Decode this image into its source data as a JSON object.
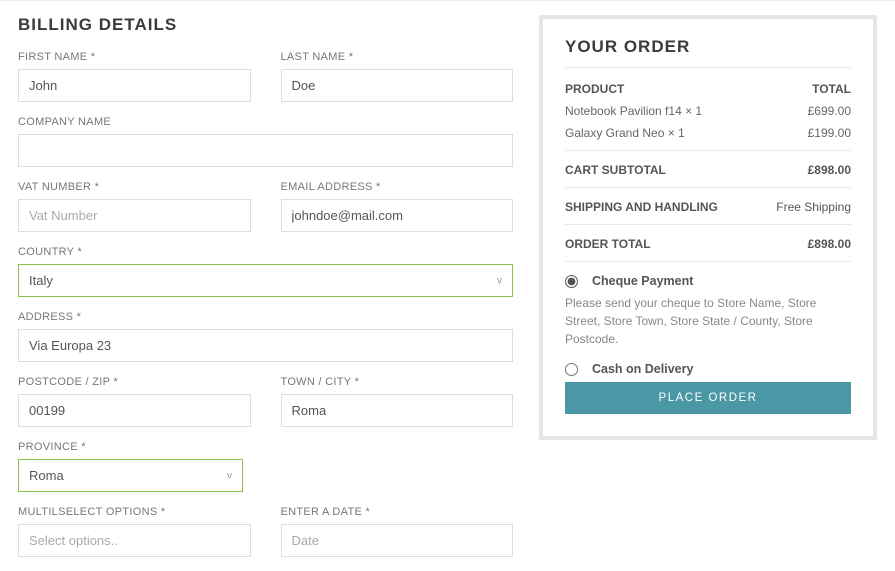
{
  "billing": {
    "heading": "BILLING DETAILS",
    "first_name_label": "FIRST NAME",
    "first_name_value": "John",
    "last_name_label": "LAST NAME",
    "last_name_value": "Doe",
    "company_label": "COMPANY NAME",
    "company_value": "",
    "vat_label": "VAT NUMBER",
    "vat_placeholder": "Vat Number",
    "vat_value": "",
    "email_label": "EMAIL ADDRESS",
    "email_value": "johndoe@mail.com",
    "country_label": "COUNTRY",
    "country_value": "Italy",
    "address_label": "ADDRESS",
    "address_value": "Via Europa 23",
    "postcode_label": "POSTCODE / ZIP",
    "postcode_value": "00199",
    "town_label": "TOWN / CITY",
    "town_value": "Roma",
    "province_label": "PROVINCE",
    "province_value": "Roma",
    "multiselect_label": "MULTILSELECT OPTIONS",
    "multiselect_placeholder": "Select options..",
    "date_label": "ENTER A DATE",
    "date_placeholder": "Date"
  },
  "order": {
    "heading": "YOUR ORDER",
    "product_col": "PRODUCT",
    "total_col": "TOTAL",
    "items": [
      {
        "name": "Notebook Pavilion f14 × 1",
        "price": "£699.00"
      },
      {
        "name": "Galaxy Grand Neo × 1",
        "price": "£199.00"
      }
    ],
    "subtotal_label": "CART SUBTOTAL",
    "subtotal_value": "£898.00",
    "shipping_label": "SHIPPING AND HANDLING",
    "shipping_value": "Free Shipping",
    "ordertotal_label": "ORDER TOTAL",
    "ordertotal_value": "£898.00",
    "pay_cheque_label": "Cheque Payment",
    "pay_cheque_desc": "Please send your cheque to Store Name, Store Street, Store Town, Store State / County, Store Postcode.",
    "pay_cod_label": "Cash on Delivery",
    "place_label": "PLACE ORDER"
  }
}
